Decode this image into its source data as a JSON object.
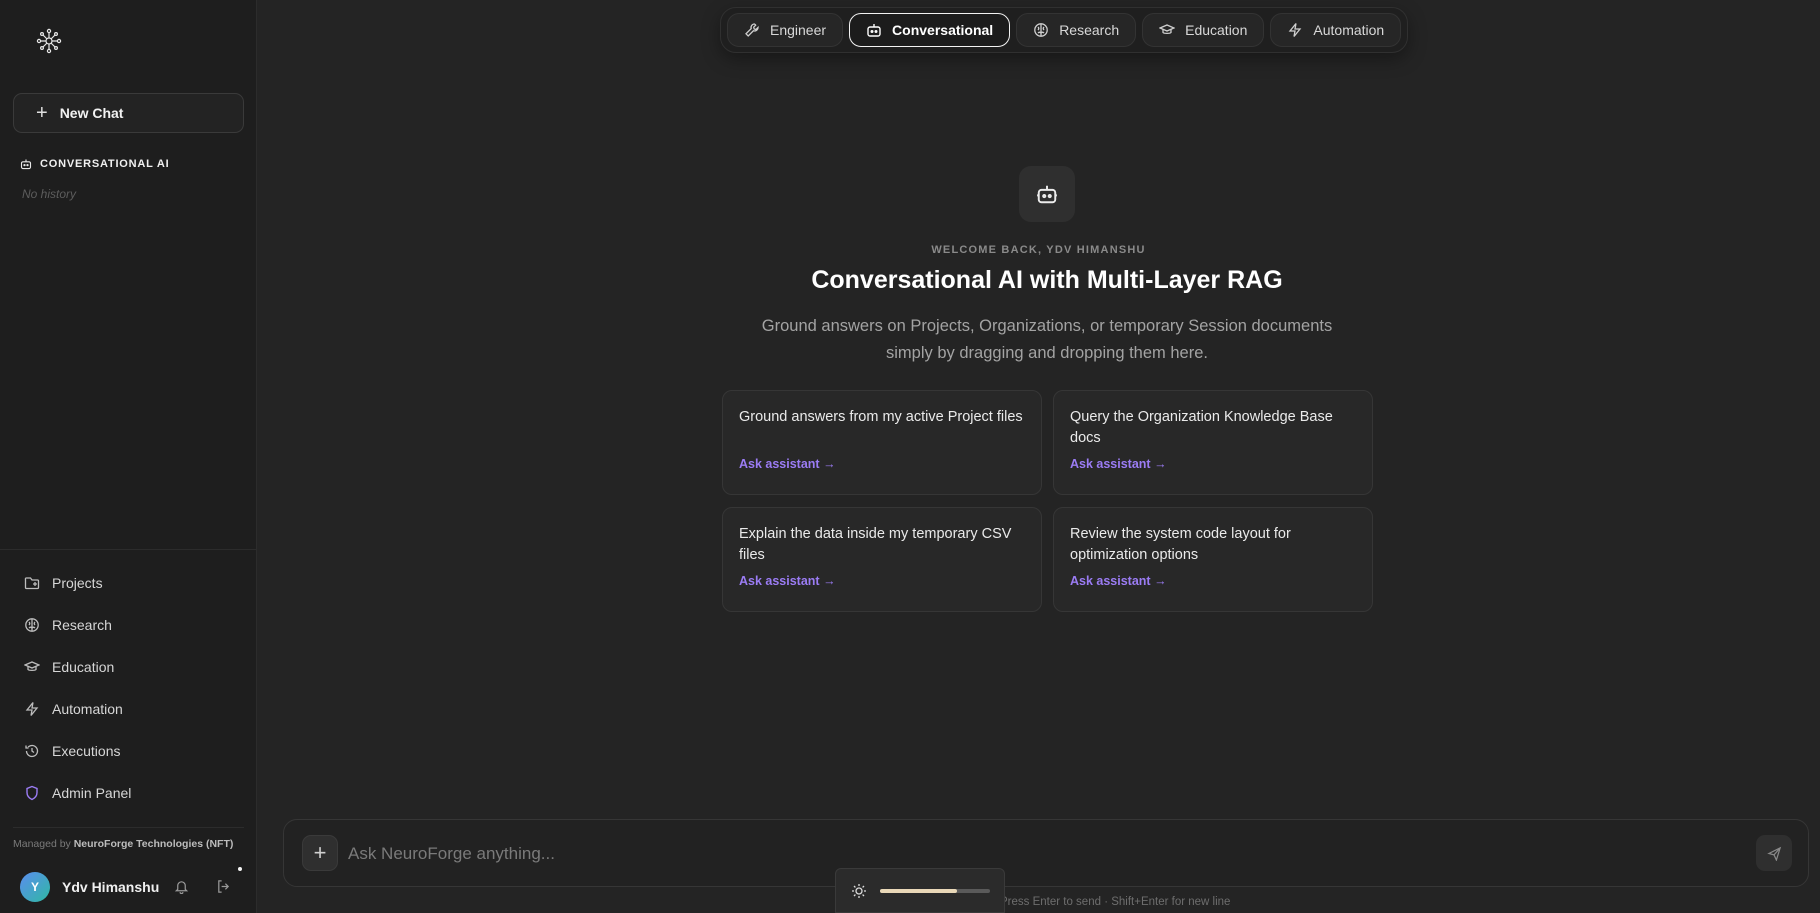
{
  "sidebar": {
    "new_chat_label": "New Chat",
    "section_title": "CONVERSATIONAL AI",
    "no_history": "No history",
    "nav": [
      {
        "label": "Projects",
        "icon": "folder-icon"
      },
      {
        "label": "Research",
        "icon": "brain-icon"
      },
      {
        "label": "Education",
        "icon": "graduation-cap-icon"
      },
      {
        "label": "Automation",
        "icon": "lightning-icon"
      },
      {
        "label": "Executions",
        "icon": "history-icon"
      },
      {
        "label": "Admin Panel",
        "icon": "shield-icon"
      }
    ],
    "managed_prefix": "Managed by",
    "managed_org": "NeuroForge Technologies (NFT)",
    "user": {
      "initial": "Y",
      "name": "Ydv Himanshu"
    }
  },
  "modes": [
    {
      "label": "Engineer",
      "icon": "wrench-icon",
      "active": false
    },
    {
      "label": "Conversational",
      "icon": "robot-icon",
      "active": true
    },
    {
      "label": "Research",
      "icon": "brain-icon",
      "active": false
    },
    {
      "label": "Education",
      "icon": "graduation-cap-icon",
      "active": false
    },
    {
      "label": "Automation",
      "icon": "lightning-icon",
      "active": false
    }
  ],
  "hero": {
    "welcome": "WELCOME BACK, YDV HIMANSHU",
    "title": "Conversational AI with Multi-Layer RAG",
    "subtitle": "Ground answers on Projects, Organizations, or temporary Session documents simply by dragging and dropping them here."
  },
  "cards": [
    {
      "text": "Ground answers from my active Project files",
      "link": "Ask assistant →"
    },
    {
      "text": "Query the Organization Knowledge Base docs",
      "link": "Ask assistant →"
    },
    {
      "text": "Explain the data inside my temporary CSV files",
      "link": "Ask assistant →"
    },
    {
      "text": "Review the system code layout for optimization options",
      "link": "Ask assistant →"
    }
  ],
  "composer": {
    "placeholder": "Ask NeuroForge anything...",
    "hint": "Press Enter to send · Shift+Enter for new line"
  },
  "brightness": {
    "level": 0.7
  },
  "colors": {
    "accent": "#9b7cf4",
    "background": "#242424",
    "sidebar": "#1e1e1e"
  }
}
